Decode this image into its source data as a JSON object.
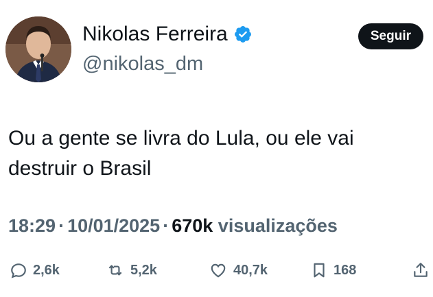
{
  "author": {
    "display_name": "Nikolas Ferreira",
    "handle": "@nikolas_dm",
    "verified": true
  },
  "follow_button_label": "Seguir",
  "tweet": {
    "text_line1": "Ou a gente se livra do Lula, ou ele vai",
    "text_line2": "destruir o Brasil"
  },
  "meta": {
    "time": "18:29",
    "date": "10/01/2025",
    "views_count": "670k",
    "views_label": "visualizações",
    "separator": "·"
  },
  "actions": {
    "replies": "2,6k",
    "retweets": "5,2k",
    "likes": "40,7k",
    "bookmarks": "168"
  },
  "colors": {
    "verified_blue": "#1d9bf0",
    "muted_text": "#536471",
    "primary_text": "#0f1419",
    "button_bg": "#0f1419"
  },
  "icons": {
    "reply": "reply-icon",
    "retweet": "retweet-icon",
    "like": "heart-icon",
    "bookmark": "bookmark-icon",
    "share": "share-icon",
    "verified": "verified-badge-icon"
  }
}
